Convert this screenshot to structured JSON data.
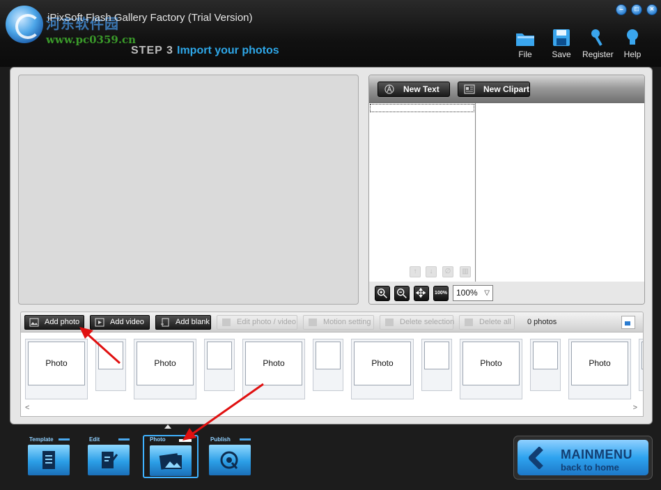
{
  "window": {
    "title": "iPixSoft Flash Gallery Factory (Trial Version)",
    "watermark_cn": "河东软件园",
    "watermark_url": "www.pc0359.cn",
    "minimize": "–",
    "maximize": "□",
    "close": "×"
  },
  "step": {
    "label": "STEP 3",
    "title": "Import your photos"
  },
  "toolbar": {
    "file": "File",
    "save": "Save",
    "register": "Register",
    "help": "Help"
  },
  "layer_panel": {
    "new_text": "New Text",
    "new_clipart": "New Clipart"
  },
  "zoom": {
    "fit_label": "100%",
    "value": "100%"
  },
  "photo_toolbar": {
    "add_photo": "Add photo",
    "add_video": "Add video",
    "add_blank": "Add blank",
    "edit_photo_video": "Edit photo / video",
    "motion_setting": "Motion setting",
    "delete_selection": "Delete selection",
    "delete_all": "Delete all",
    "count": "0 photos"
  },
  "photo_strip": {
    "slots": [
      "Photo",
      "Photo",
      "Photo",
      "Photo",
      "Photo",
      "Photo"
    ],
    "scroll_left": "<",
    "scroll_right": ">"
  },
  "nav": {
    "template": "Template",
    "edit": "Edit",
    "photo": "Photo",
    "publish": "Publish",
    "active": "Photo"
  },
  "main_menu": {
    "title": "MAINMENU",
    "subtitle": "back to home"
  },
  "colors": {
    "accent": "#2ea7e8",
    "annotation": "#e01010",
    "panel": "#e6e6e6"
  }
}
